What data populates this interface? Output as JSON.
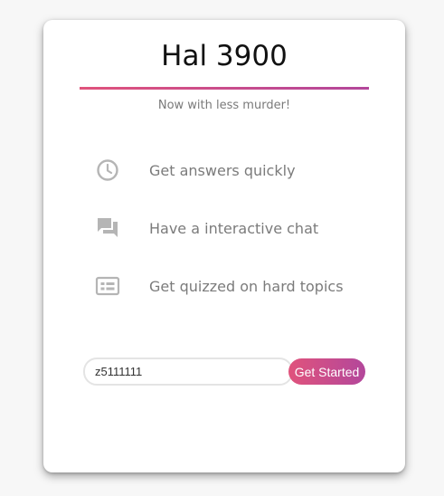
{
  "header": {
    "title": "Hal 3900",
    "subtitle": "Now with less murder!"
  },
  "features": [
    {
      "icon": "clock-icon",
      "label": "Get answers quickly"
    },
    {
      "icon": "chat-icon",
      "label": "Have a interactive chat"
    },
    {
      "icon": "quiz-card-icon",
      "label": "Get quizzed on hard topics"
    }
  ],
  "form": {
    "id_value": "z5111111",
    "button_label": "Get Started"
  },
  "colors": {
    "accent_start": "#e0537c",
    "accent_end": "#b3479b",
    "icon_gray": "#b5b5b5",
    "text_gray": "#7b7b7b"
  }
}
